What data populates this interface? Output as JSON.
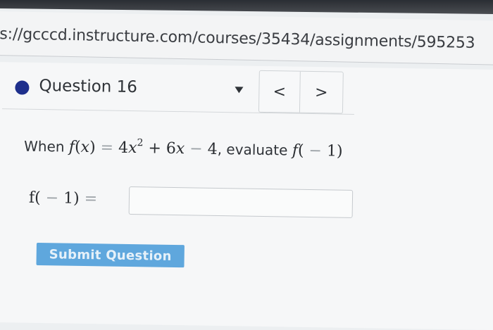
{
  "browser": {
    "url": "s://gcccd.instructure.com/courses/35434/assignments/595253"
  },
  "question": {
    "label": "Question 16",
    "nav_prev": "<",
    "nav_next": ">",
    "prompt_when": "When",
    "prompt_evaluate": ", evaluate",
    "answer_label_prefix": "f(",
    "answer_label_minus": "−",
    "answer_label_arg": "1)",
    "answer_label_eq": "=",
    "answer_value": "",
    "submit_label": "Submit Question"
  },
  "colors": {
    "question_dot": "#1e2f8c",
    "submit_button": "#5fa7dd"
  }
}
